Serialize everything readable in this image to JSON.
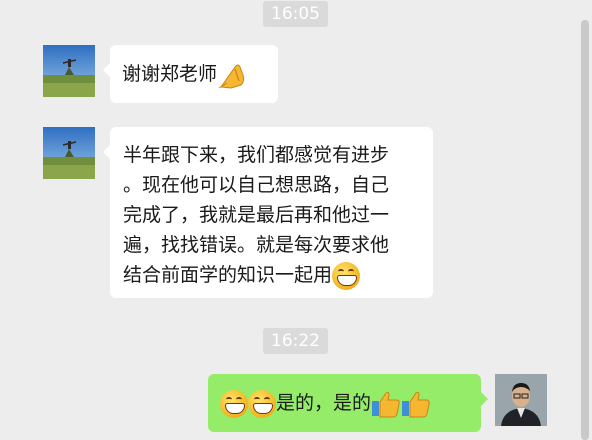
{
  "timestamps": [
    "16:05",
    "16:22"
  ],
  "messages": [
    {
      "sender": "them",
      "text": "谢谢郑老师",
      "trailing_emoji": "pray-icon"
    },
    {
      "sender": "them",
      "text": "半年跟下来，我们都感觉有进步\n。现在他可以自己想思路，自己\n完成了，我就是最后再和他过一\n遍，找找错误。就是每次要求他\n结合前面学的知识一起用",
      "trailing_emoji": "grin-icon"
    },
    {
      "sender": "me",
      "leading_emojis": [
        "grin-icon",
        "grin-icon"
      ],
      "text": "是的，是的",
      "trailing_emojis": [
        "thumbs-up-icon",
        "thumbs-up-icon"
      ]
    }
  ],
  "colors": {
    "background": "#ededed",
    "incoming_bubble": "#ffffff",
    "outgoing_bubble": "#95ec69",
    "timestamp_bg": "#dadada",
    "timestamp_text": "#ffffff"
  }
}
